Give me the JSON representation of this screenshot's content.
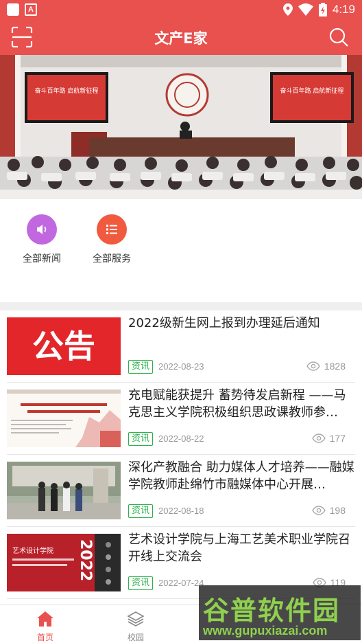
{
  "status_bar": {
    "time": "4:19",
    "app_badge": "A"
  },
  "app_bar": {
    "title": "文产E家"
  },
  "banner": {
    "screen_text_left": "奋斗百年路 启航新征程",
    "screen_text_right": "奋斗百年路 启航新征程"
  },
  "quick_entries": [
    {
      "label": "全部新闻",
      "icon": "speaker-icon",
      "color": "#c168e0"
    },
    {
      "label": "全部服务",
      "icon": "list-icon",
      "color": "#f05a3e"
    }
  ],
  "news": [
    {
      "title": "2022级新生网上报到办理延后通知",
      "tag": "资讯",
      "date": "2022-08-23",
      "views": "1828",
      "thumb_text": "公告"
    },
    {
      "title": "充电赋能获提升 蓄势待发启新程 ——马克思主义学院积极组织思政课教师参…",
      "tag": "资讯",
      "date": "2022-08-22",
      "views": "177"
    },
    {
      "title": "深化产教融合 助力媒体人才培养——融媒学院教师赴绵竹市融媒体中心开展…",
      "tag": "资讯",
      "date": "2022-08-18",
      "views": "198"
    },
    {
      "title": "艺术设计学院与上海工艺美术职业学院召开线上交流会",
      "tag": "资讯",
      "date": "2022-07-24",
      "views": "119",
      "thumb_text": "艺术设计学院",
      "thumb_year": "2022"
    }
  ],
  "bottom_nav": [
    {
      "label": "首页",
      "icon": "home-icon",
      "active": true
    },
    {
      "label": "校园",
      "icon": "layers-icon",
      "active": false
    }
  ],
  "watermark": {
    "title": "谷普软件园",
    "url": "www.gupuxiazai.com"
  },
  "colors": {
    "brand": "#e8514e",
    "tag": "#2bb24c"
  }
}
